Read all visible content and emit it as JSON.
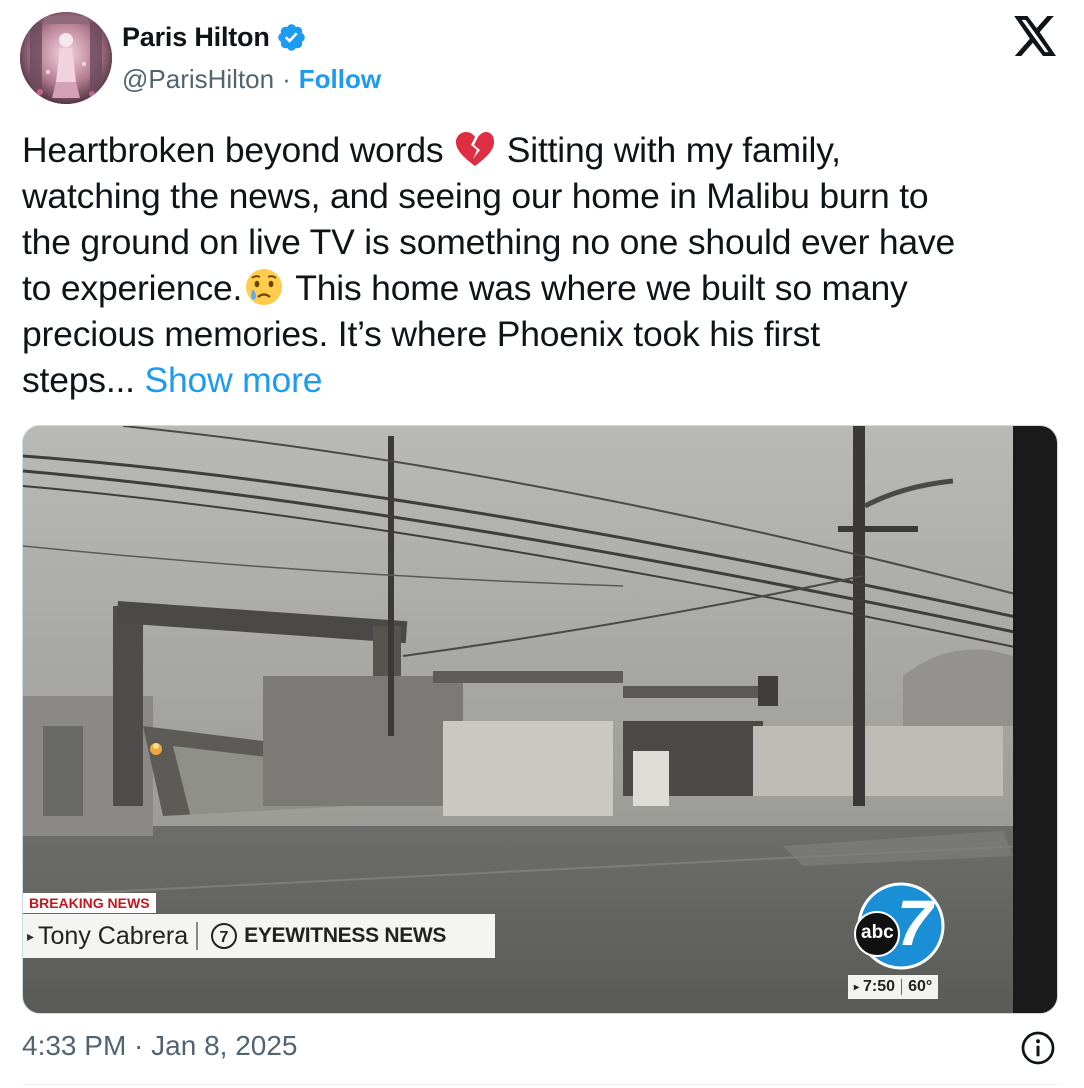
{
  "author": {
    "display_name": "Paris Hilton",
    "handle": "@ParisHilton",
    "separator": "·",
    "follow_label": "Follow",
    "verified_color": "#1d9bf0"
  },
  "tweet": {
    "lines": [
      [
        "Heartbroken beyond words ",
        "broken-heart-emoji",
        " Sitting with my family,"
      ],
      [
        "watching the news, and seeing our home in Malibu burn to"
      ],
      [
        "the ground on live TV is something no one should ever have"
      ],
      [
        "to experience.",
        "crying-face-emoji",
        " This home was where we built so many"
      ],
      [
        "precious memories. It’s where Phoenix took his first"
      ]
    ],
    "last_line_text": "steps... ",
    "show_more_label": "Show more"
  },
  "media": {
    "breaking_label": "BREAKING NEWS",
    "reporter_name": "Tony Cabrera",
    "station_label": "EYEWITNESS NEWS",
    "logo_text": "abc",
    "logo_number": "7",
    "time_text": "7:50",
    "temp_text": "60°"
  },
  "meta": {
    "timestamp": "4:33 PM · Jan 8, 2025"
  },
  "colors": {
    "accent": "#1d9bf0",
    "text": "#0f1419",
    "secondary": "#536471"
  },
  "icons": [
    "verified-badge-icon",
    "x-logo-icon",
    "info-icon"
  ]
}
